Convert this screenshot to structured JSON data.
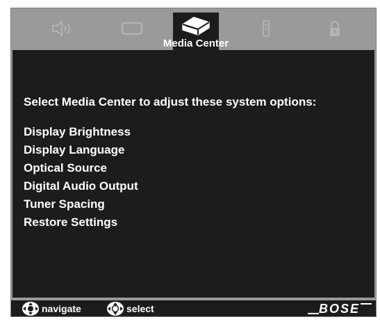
{
  "tabs": [
    {
      "name": "audio",
      "icon": "speaker-icon",
      "selected": false
    },
    {
      "name": "video",
      "icon": "screen-icon",
      "selected": false
    },
    {
      "name": "media-center",
      "icon": "media-center-icon",
      "selected": true
    },
    {
      "name": "remote",
      "icon": "remote-icon",
      "selected": false
    },
    {
      "name": "lock",
      "icon": "lock-icon",
      "selected": false
    }
  ],
  "screen": {
    "title": "Media Center",
    "prompt": "Select Media Center to adjust these system options:",
    "options": [
      "Display Brightness",
      "Display Language",
      "Optical Source",
      "Digital Audio Output",
      "Tuner Spacing",
      "Restore Settings"
    ]
  },
  "footer": {
    "navigate_label": "navigate",
    "select_label": "select",
    "brand": "BOSE"
  },
  "colors": {
    "frame": "#9a9a9a",
    "panel": "#1c1c1c",
    "text": "#ffffff",
    "dim_icon": "#b4b4b4"
  }
}
